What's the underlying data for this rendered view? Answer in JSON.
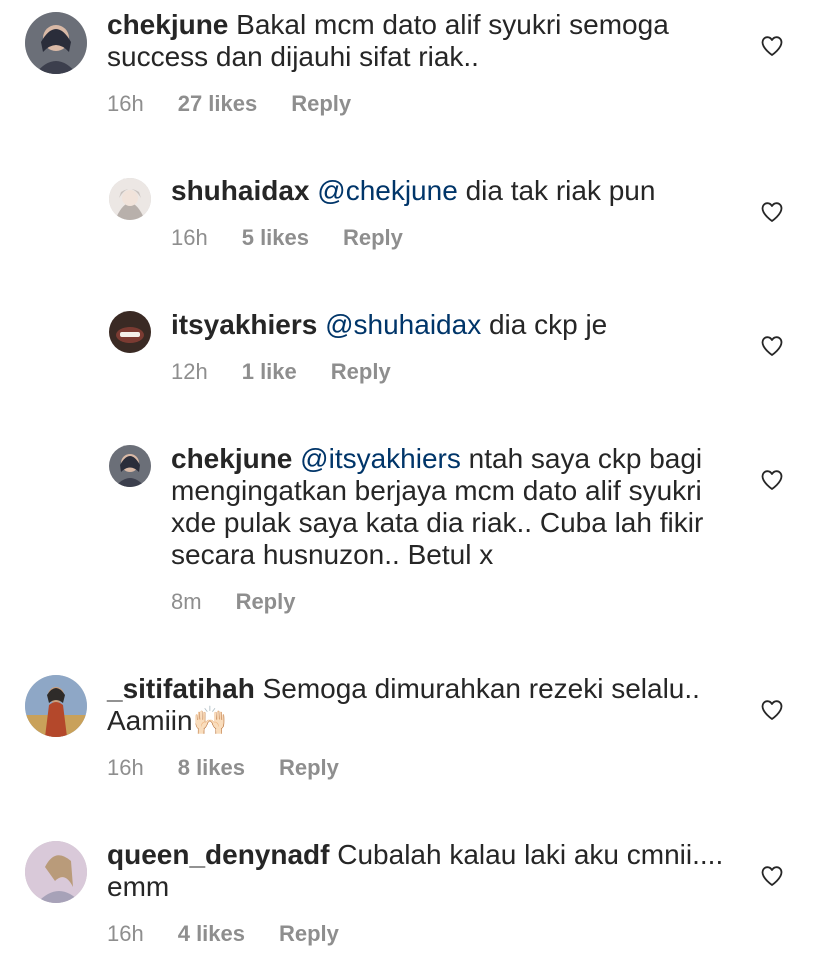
{
  "comments": [
    {
      "username": "chekjune",
      "mention": "",
      "text": "Bakal mcm  dato alif syukri  semoga success dan dijauhi sifat riak..",
      "time": "16h",
      "likes": "27 likes",
      "reply": "Reply",
      "is_reply": false
    },
    {
      "username": "shuhaidax",
      "mention": "@chekjune",
      "text": "dia tak riak pun",
      "time": "16h",
      "likes": "5 likes",
      "reply": "Reply",
      "is_reply": true
    },
    {
      "username": "itsyakhiers",
      "mention": "@shuhaidax",
      "text": "dia ckp je",
      "time": "12h",
      "likes": "1 like",
      "reply": "Reply",
      "is_reply": true
    },
    {
      "username": "chekjune",
      "mention": "@itsyakhiers",
      "text": "ntah saya ckp bagi mengingatkan berjaya mcm dato alif syukri xde pulak saya kata dia riak.. Cuba lah fikir secara husnuzon.. Betul x",
      "time": "8m",
      "likes": "",
      "reply": "Reply",
      "is_reply": true
    },
    {
      "username": "_sitifatihah",
      "mention": "",
      "text": "Semoga dimurahkan rezeki selalu.. Aamiin🙌🏻",
      "time": "16h",
      "likes": "8 likes",
      "reply": "Reply",
      "is_reply": false
    },
    {
      "username": "queen_denynadf",
      "mention": "",
      "text": "Cubalah kalau laki aku cmnii.... emm",
      "time": "16h",
      "likes": "4 likes",
      "reply": "Reply",
      "is_reply": false
    }
  ],
  "icons": {
    "like": "heart-outline-icon"
  },
  "colors": {
    "text": "#262626",
    "meta": "#8e8e8e",
    "mention": "#003569",
    "heart_stroke": "#262626"
  }
}
